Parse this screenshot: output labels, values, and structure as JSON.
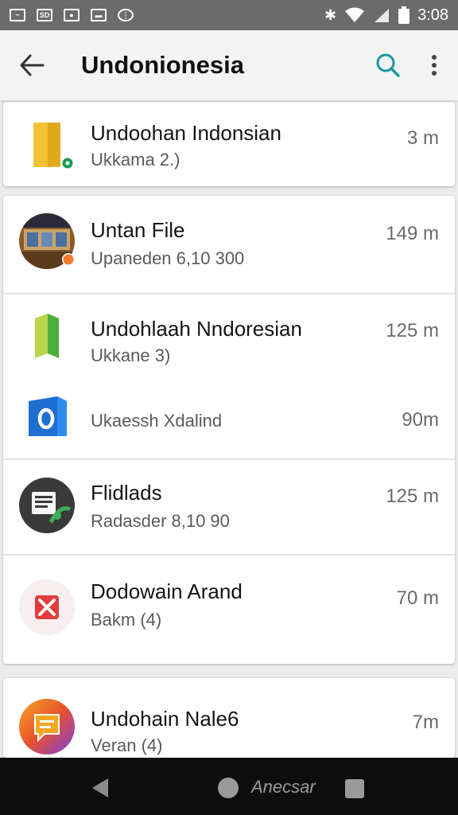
{
  "status_bar": {
    "time": "3:08",
    "icons": [
      "image-icon",
      "sd-card-icon",
      "photo-icon",
      "message-icon",
      "usb-icon"
    ]
  },
  "app_bar": {
    "title": "Undonionesia"
  },
  "items": [
    {
      "title": "Undoohan Indonsian",
      "subtitle": "Ukkama 2.)",
      "size": "3 m",
      "icon": "folder-icon",
      "color": "#f2c233"
    },
    {
      "title": "Untan File",
      "subtitle": "Upaneden 6,10 300",
      "size": "149 m",
      "icon": "storefront-photo-icon",
      "color": "#8a5a2b"
    },
    {
      "title": "Undohlaah Nndoresian",
      "subtitle": "Ukkane 3)",
      "size": "125 m",
      "icon": "green-folder-icon",
      "color": "#6fb83a"
    },
    {
      "title": "Ukaessh Xdalind",
      "subtitle": "",
      "size": "90m",
      "icon": "outlook-icon",
      "color": "#1e6fd1"
    },
    {
      "title": "Flidlads",
      "subtitle": "Radasder 8,10 90",
      "size": "125 m",
      "icon": "document-sync-icon",
      "color": "#3a3a3a"
    },
    {
      "title": "Dodowain Arand",
      "subtitle": "Bakm (4)",
      "size": "70 m",
      "icon": "pdf-icon",
      "color": "#e23b3b"
    },
    {
      "title": "Undohain Nale6",
      "subtitle": "Veran (4)",
      "size": "7m",
      "icon": "chat-icon",
      "color": "#e8502d"
    }
  ],
  "nav_bar": {
    "label": "Anecsar"
  }
}
